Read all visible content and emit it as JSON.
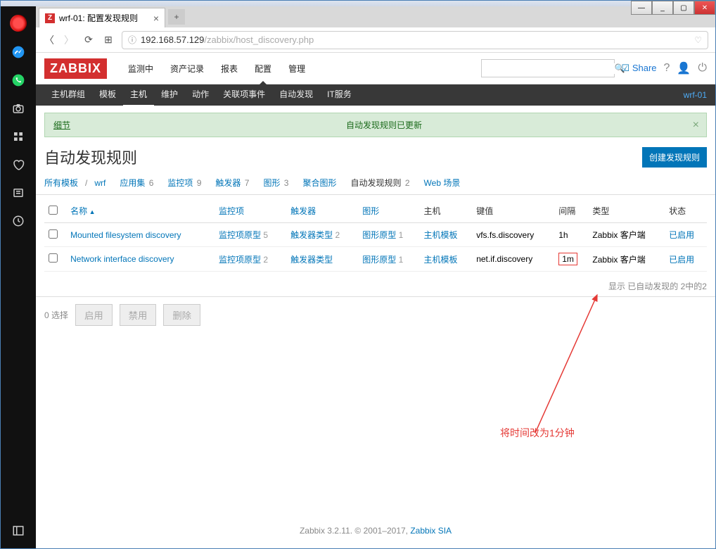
{
  "window": {
    "tab_title": "wrf-01: 配置发现规则"
  },
  "address": {
    "host": "192.168.57.129",
    "path": "/zabbix/host_discovery.php"
  },
  "logo": "ZABBIX",
  "top_menu": [
    "监测中",
    "资产记录",
    "报表",
    "配置",
    "管理"
  ],
  "top_menu_active_index": 3,
  "sub_menu": [
    "主机群组",
    "模板",
    "主机",
    "维护",
    "动作",
    "关联项事件",
    "自动发现",
    "IT服务"
  ],
  "sub_menu_active_index": 2,
  "host_label": "wrf-01",
  "share": "Share",
  "notice": {
    "detail": "细节",
    "msg": "自动发现规则已更新",
    "close": "×"
  },
  "page_title": "自动发现规则",
  "create_btn": "创建发现规则",
  "crumbs": {
    "all_templates": "所有模板",
    "host": "wrf",
    "items": [
      {
        "label": "应用集",
        "count": "6"
      },
      {
        "label": "监控项",
        "count": "9"
      },
      {
        "label": "触发器",
        "count": "7"
      },
      {
        "label": "图形",
        "count": "3"
      },
      {
        "label": "聚合图形",
        "count": ""
      },
      {
        "label": "自动发现规则",
        "count": "2",
        "current": true
      },
      {
        "label": "Web 场景",
        "count": ""
      }
    ]
  },
  "table": {
    "headers": {
      "name": "名称",
      "items": "监控项",
      "triggers": "触发器",
      "graphs": "图形",
      "hosts": "主机",
      "key": "键值",
      "interval": "间隔",
      "type": "类型",
      "status": "状态"
    },
    "rows": [
      {
        "name": "Mounted filesystem discovery",
        "items": "监控项原型",
        "items_n": "5",
        "triggers": "触发器类型",
        "triggers_n": "2",
        "graphs": "图形原型",
        "graphs_n": "1",
        "hosts": "主机模板",
        "key": "vfs.fs.discovery",
        "interval": "1h",
        "hl": false,
        "type": "Zabbix 客户端",
        "status": "已启用"
      },
      {
        "name": "Network interface discovery",
        "items": "监控项原型",
        "items_n": "2",
        "triggers": "触发器类型",
        "triggers_n": "",
        "graphs": "图形原型",
        "graphs_n": "1",
        "hosts": "主机模板",
        "key": "net.if.discovery",
        "interval": "1m",
        "hl": true,
        "type": "Zabbix 客户端",
        "status": "已启用"
      }
    ]
  },
  "footer_count": "显示 已自动发现的 2中的2",
  "bulk": {
    "selected": "0 选择",
    "enable": "启用",
    "disable": "禁用",
    "delete": "删除"
  },
  "annotation": "将时间改为1分钟",
  "footer": {
    "text": "Zabbix 3.2.11. © 2001–2017, ",
    "link": "Zabbix SIA"
  }
}
